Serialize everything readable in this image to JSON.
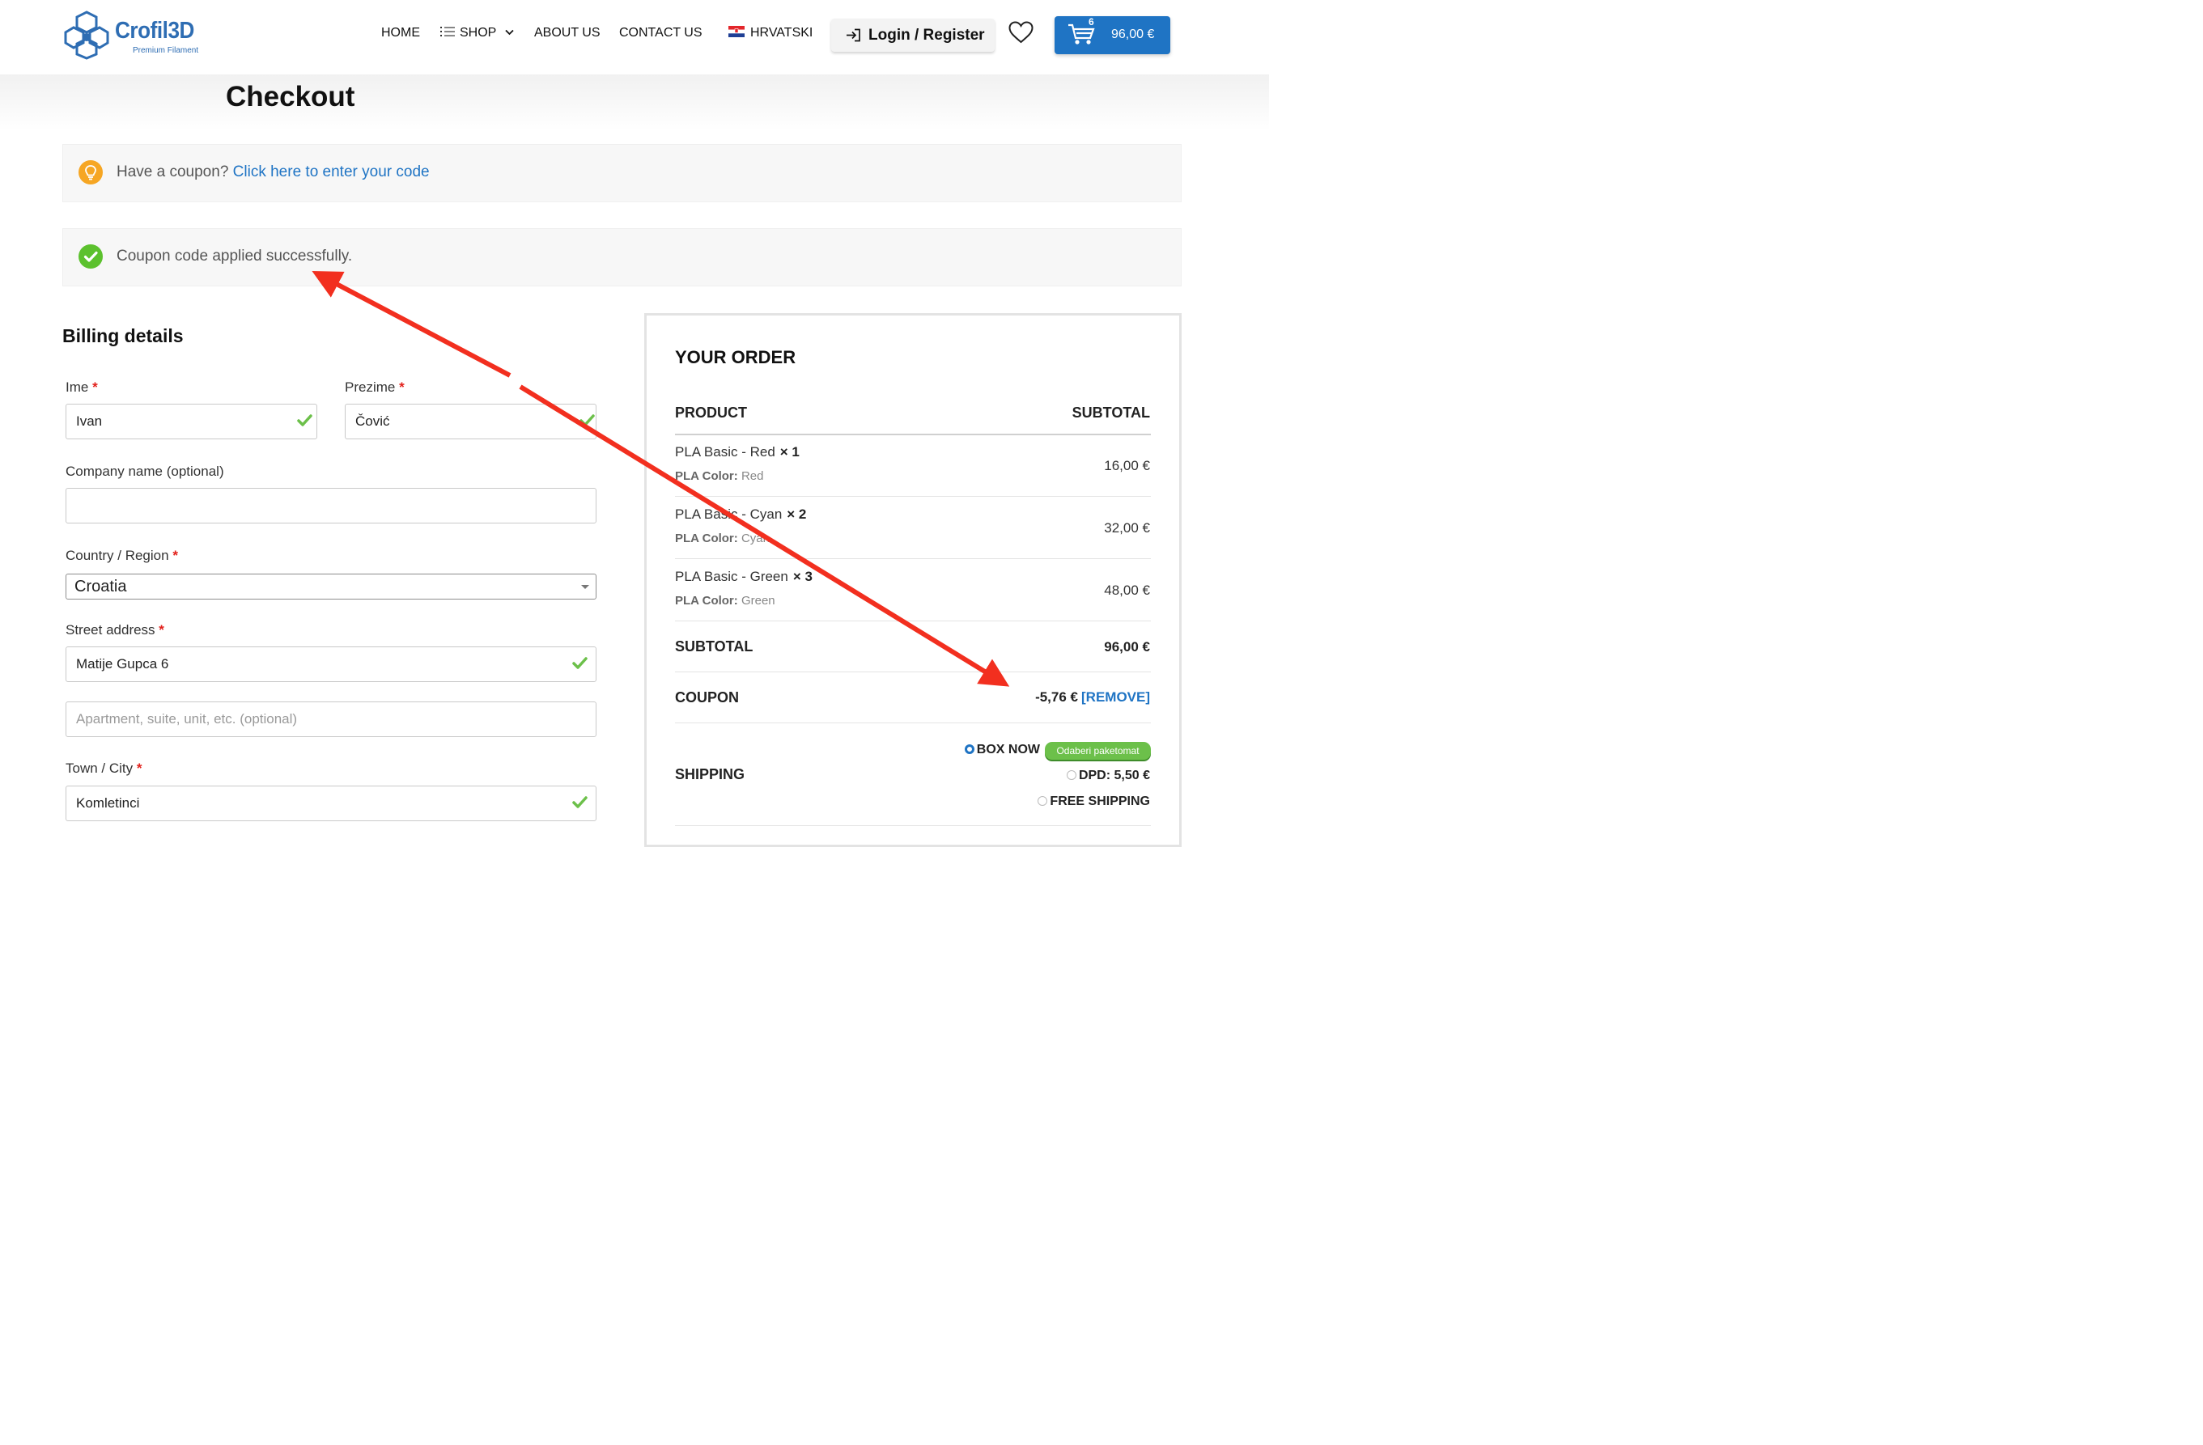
{
  "brand": {
    "name": "Crofil3D",
    "tagline": "Premium Filament"
  },
  "nav": {
    "home": "HOME",
    "shop": "SHOP",
    "about": "ABOUT US",
    "contact": "CONTACT US",
    "language": "HRVATSKI",
    "login": "Login / Register",
    "cart_count": "6",
    "cart_total": "96,00 €"
  },
  "page": {
    "title": "Checkout"
  },
  "notices": {
    "coupon_prompt": "Have a coupon?",
    "coupon_link": "Click here to enter your code",
    "coupon_applied": "Coupon code applied successfully."
  },
  "billing": {
    "title": "Billing details",
    "first_name": {
      "label": "Ime",
      "value": "Ivan"
    },
    "last_name": {
      "label": "Prezime",
      "value": "Čović"
    },
    "company": {
      "label": "Company name (optional)",
      "value": ""
    },
    "country": {
      "label": "Country / Region",
      "value": "Croatia"
    },
    "street": {
      "label": "Street address",
      "value": "Matije Gupca 6"
    },
    "apartment": {
      "placeholder": "Apartment, suite, unit, etc. (optional)"
    },
    "city": {
      "label": "Town / City",
      "value": "Komletinci"
    },
    "required_mark": "*"
  },
  "order": {
    "title": "YOUR ORDER",
    "col_product": "PRODUCT",
    "col_subtotal": "SUBTOTAL",
    "items": [
      {
        "name": "PLA Basic - Red",
        "qty": "× 1",
        "meta_label": "PLA Color:",
        "meta_value": "Red",
        "price": "16,00 €"
      },
      {
        "name": "PLA Basic - Cyan",
        "qty": "× 2",
        "meta_label": "PLA Color:",
        "meta_value": "Cyan",
        "price": "32,00 €"
      },
      {
        "name": "PLA Basic - Green",
        "qty": "× 3",
        "meta_label": "PLA Color:",
        "meta_value": "Green",
        "price": "48,00 €"
      }
    ],
    "subtotal_label": "SUBTOTAL",
    "subtotal_value": "96,00 €",
    "coupon_label": "COUPON",
    "coupon_value": "-5,76 €",
    "coupon_remove": "[REMOVE]",
    "shipping_label": "SHIPPING",
    "shipping_options": [
      {
        "label": "BOX NOW",
        "selected": true
      },
      {
        "label": "DPD: 5,50 €",
        "selected": false
      },
      {
        "label": "FREE SHIPPING",
        "selected": false
      }
    ],
    "locker_badge": "Odaberi paketomat"
  },
  "colors": {
    "brand_blue": "#1f74c4",
    "required_red": "#e2201b",
    "success_green": "#6cc04a",
    "annotation_red": "#f22f1f",
    "info_orange": "#f6a623"
  }
}
